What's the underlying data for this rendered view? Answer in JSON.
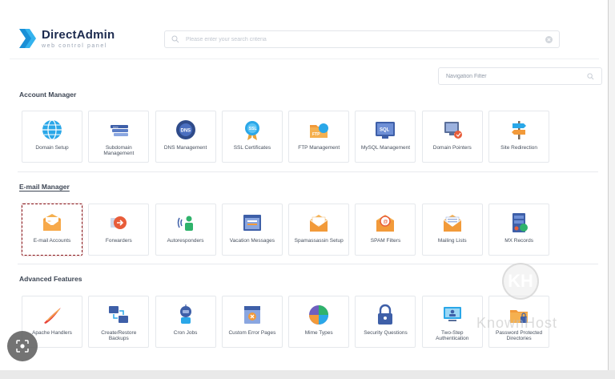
{
  "brand": {
    "title": "DirectAdmin",
    "subtitle": "web control panel"
  },
  "search": {
    "placeholder": "Please enter your search criteria"
  },
  "nav_filter": {
    "placeholder": "Navigation Filter"
  },
  "sections": {
    "account": {
      "title": "Account Manager",
      "items": [
        {
          "label": "Domain Setup",
          "icon": "globe-icon"
        },
        {
          "label": "Subdomain Management",
          "icon": "subdomain-icon"
        },
        {
          "label": "DNS Management",
          "icon": "dns-icon"
        },
        {
          "label": "SSL Certificates",
          "icon": "ssl-certificate-icon"
        },
        {
          "label": "FTP Management",
          "icon": "ftp-folder-icon"
        },
        {
          "label": "MySQL Management",
          "icon": "sql-database-icon"
        },
        {
          "label": "Domain Pointers",
          "icon": "domain-pointer-icon"
        },
        {
          "label": "Site Redirection",
          "icon": "signpost-icon"
        }
      ]
    },
    "email": {
      "title": "E-mail Manager",
      "items": [
        {
          "label": "E-mail Accounts",
          "icon": "envelope-icon"
        },
        {
          "label": "Forwarders",
          "icon": "forward-arrow-icon"
        },
        {
          "label": "Autoresponders",
          "icon": "autoresponder-icon"
        },
        {
          "label": "Vacation Messages",
          "icon": "vacation-message-icon"
        },
        {
          "label": "Spamassassin Setup",
          "icon": "spamassassin-envelope-icon"
        },
        {
          "label": "SPAM Filters",
          "icon": "spam-filter-icon"
        },
        {
          "label": "Mailing Lists",
          "icon": "mailing-list-icon"
        },
        {
          "label": "MX Records",
          "icon": "mx-records-icon"
        }
      ]
    },
    "advanced": {
      "title": "Advanced Features",
      "items": [
        {
          "label": "Apache Handlers",
          "icon": "apache-feather-icon"
        },
        {
          "label": "Create/Restore Backups",
          "icon": "backup-computers-icon"
        },
        {
          "label": "Cron Jobs",
          "icon": "cron-robot-icon"
        },
        {
          "label": "Custom Error Pages",
          "icon": "error-page-icon"
        },
        {
          "label": "Mime Types",
          "icon": "mime-types-icon"
        },
        {
          "label": "Security Questions",
          "icon": "padlock-icon"
        },
        {
          "label": "Two-Step Authentication",
          "icon": "two-step-auth-icon"
        },
        {
          "label": "Password Protected Directories",
          "icon": "protected-folder-icon"
        }
      ]
    }
  },
  "watermark": {
    "text": "KnownHost",
    "mark": "KH"
  },
  "colors": {
    "brand_blue": "#1a8fd6",
    "selected_border": "#8b1a1f"
  }
}
